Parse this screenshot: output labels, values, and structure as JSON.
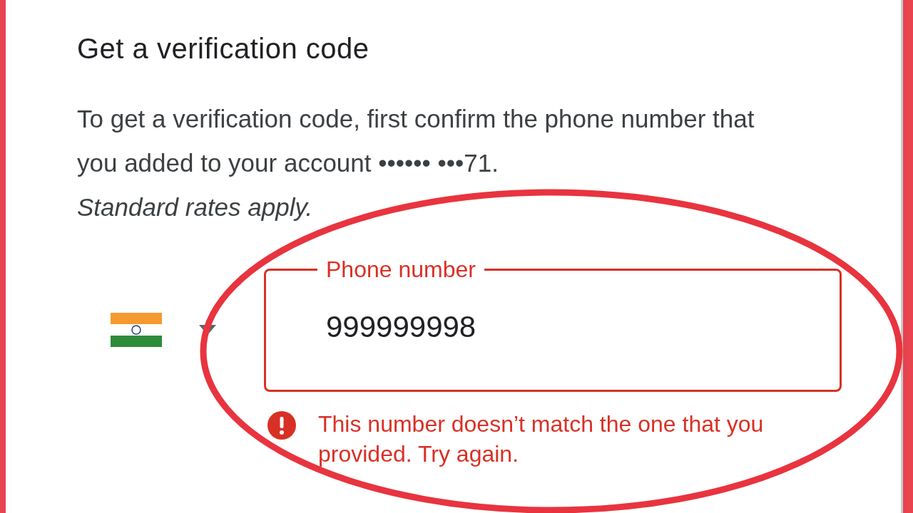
{
  "title": "Get a verification code",
  "description": "To get a verification code, first confirm the phone number that you added to your account •••••• •••71.",
  "note": "Standard rates apply.",
  "phone_field": {
    "label": "Phone number",
    "value": "999999998",
    "error": true
  },
  "error_message": "This number doesn’t match the one that you provided. Try again."
}
